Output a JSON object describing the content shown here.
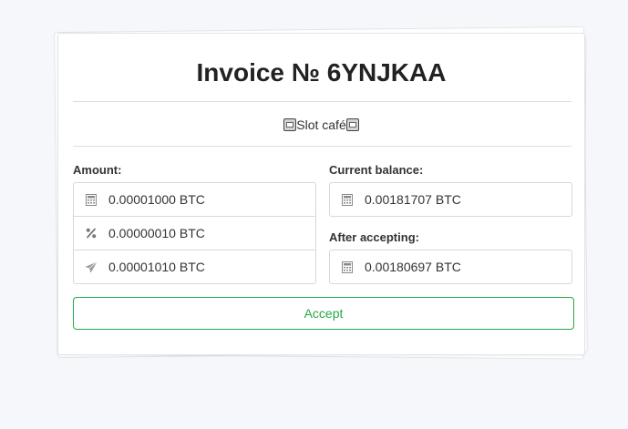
{
  "invoice": {
    "title": "Invoice № 6YNJKAA",
    "merchant": "Slot café"
  },
  "left": {
    "label": "Amount:",
    "rows": [
      {
        "icon": "calculator-icon",
        "value": "0.00001000 BTC"
      },
      {
        "icon": "percent-icon",
        "value": "0.00000010 BTC"
      },
      {
        "icon": "send-icon",
        "value": "0.00001010 BTC"
      }
    ]
  },
  "right": {
    "balance_label": "Current balance:",
    "balance_value": "0.00181707 BTC",
    "after_label": "After accepting:",
    "after_value": "0.00180697 BTC"
  },
  "actions": {
    "accept_label": "Accept"
  },
  "colors": {
    "accent": "#28a745",
    "background": "#f6f7fb"
  }
}
